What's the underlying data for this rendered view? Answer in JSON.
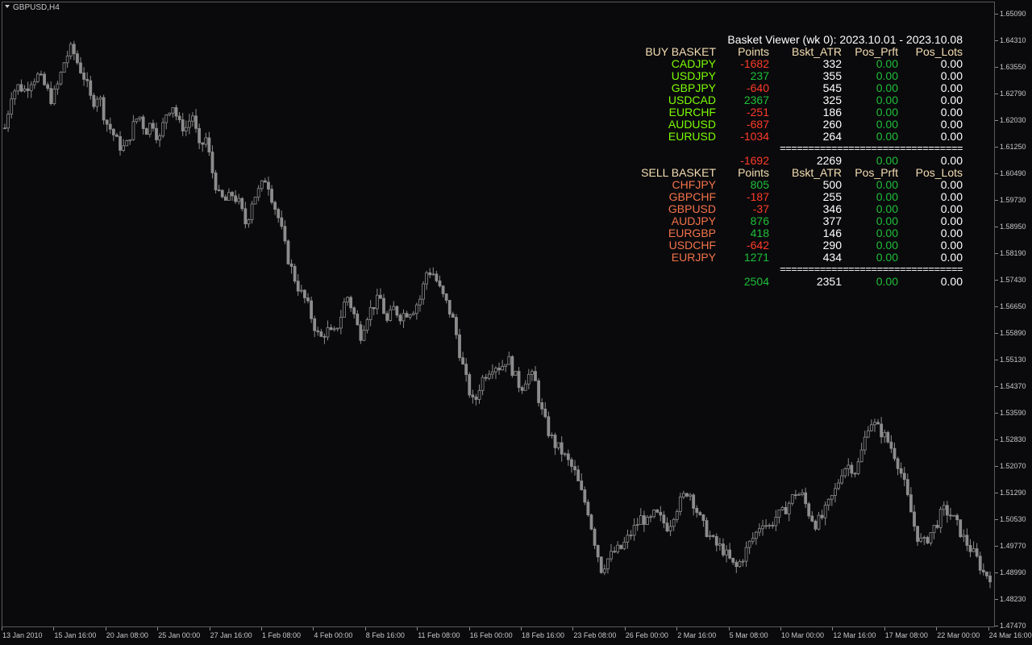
{
  "window": {
    "title": "GBPUSD,H4"
  },
  "price_axis": [
    "1.65090",
    "1.64310",
    "1.63550",
    "1.62790",
    "1.62030",
    "1.61250",
    "1.60490",
    "1.59730",
    "1.58950",
    "1.58190",
    "1.57430",
    "1.56650",
    "1.55890",
    "1.55130",
    "1.54370",
    "1.53590",
    "1.52830",
    "1.52070",
    "1.51290",
    "1.50530",
    "1.49770",
    "1.48990",
    "1.48230",
    "1.47470"
  ],
  "time_axis": [
    "13 Jan 2010",
    "15 Jan 16:00",
    "20 Jan 08:00",
    "25 Jan 00:00",
    "27 Jan 16:00",
    "1 Feb 08:00",
    "4 Feb 00:00",
    "8 Feb 16:00",
    "11 Feb 08:00",
    "16 Feb 00:00",
    "18 Feb 16:00",
    "23 Feb 08:00",
    "26 Feb 00:00",
    "2 Mar 16:00",
    "5 Mar 08:00",
    "10 Mar 00:00",
    "12 Mar 16:00",
    "17 Mar 08:00",
    "22 Mar 00:00",
    "24 Mar 16:00"
  ],
  "colors": {
    "background": "#0a0a0c",
    "candle": "#8c8c8c",
    "buy_symbol": "#7cfc00",
    "sell_symbol": "#f4734a",
    "positive": "#1fbf3a",
    "negative": "#ff3b2a",
    "header": "#f5deb3"
  },
  "basket_viewer": {
    "title": "Basket Viewer (wk 0): 2023.10.01  -   2023.10.08",
    "buy": {
      "header": {
        "name": "BUY BASKET",
        "points": "Points",
        "atr": "Bskt_ATR",
        "profit": "Pos_Prft",
        "lots": "Pos_Lots"
      },
      "rows": [
        {
          "symbol": "CADJPY",
          "points": "-1682",
          "atr": "332",
          "profit": "0.00",
          "lots": "0.00"
        },
        {
          "symbol": "USDJPY",
          "points": "237",
          "atr": "355",
          "profit": "0.00",
          "lots": "0.00"
        },
        {
          "symbol": "GBPJPY",
          "points": "-640",
          "atr": "545",
          "profit": "0.00",
          "lots": "0.00"
        },
        {
          "symbol": "USDCAD",
          "points": "2367",
          "atr": "325",
          "profit": "0.00",
          "lots": "0.00"
        },
        {
          "symbol": "EURCHF",
          "points": "-251",
          "atr": "186",
          "profit": "0.00",
          "lots": "0.00"
        },
        {
          "symbol": "AUDUSD",
          "points": "-687",
          "atr": "260",
          "profit": "0.00",
          "lots": "0.00"
        },
        {
          "symbol": "EURUSD",
          "points": "-1034",
          "atr": "264",
          "profit": "0.00",
          "lots": "0.00"
        }
      ],
      "separator": "================================",
      "total": {
        "points": "-1692",
        "atr": "2269",
        "profit": "0.00",
        "lots": "0.00"
      }
    },
    "sell": {
      "header": {
        "name": "SELL BASKET",
        "points": "Points",
        "atr": "Bskt_ATR",
        "profit": "Pos_Prft",
        "lots": "Pos_Lots"
      },
      "rows": [
        {
          "symbol": "CHFJPY",
          "points": "805",
          "atr": "500",
          "profit": "0.00",
          "lots": "0.00"
        },
        {
          "symbol": "GBPCHF",
          "points": "-187",
          "atr": "255",
          "profit": "0.00",
          "lots": "0.00"
        },
        {
          "symbol": "GBPUSD",
          "points": "-37",
          "atr": "346",
          "profit": "0.00",
          "lots": "0.00"
        },
        {
          "symbol": "AUDJPY",
          "points": "876",
          "atr": "377",
          "profit": "0.00",
          "lots": "0.00"
        },
        {
          "symbol": "EURGBP",
          "points": "418",
          "atr": "146",
          "profit": "0.00",
          "lots": "0.00"
        },
        {
          "symbol": "USDCHF",
          "points": "-642",
          "atr": "290",
          "profit": "0.00",
          "lots": "0.00"
        },
        {
          "symbol": "EURJPY",
          "points": "1271",
          "atr": "434",
          "profit": "0.00",
          "lots": "0.00"
        }
      ],
      "separator": "================================",
      "total": {
        "points": "2504",
        "atr": "2351",
        "profit": "0.00",
        "lots": "0.00"
      }
    }
  },
  "chart_data": {
    "type": "candlestick",
    "symbol": "GBPUSD",
    "timeframe": "H4",
    "ylim": [
      1.4747,
      1.6509
    ],
    "close_path": [
      1.618,
      1.628,
      1.63,
      1.629,
      1.632,
      1.633,
      1.63,
      1.626,
      1.631,
      1.638,
      1.641,
      1.636,
      1.632,
      1.625,
      1.628,
      1.62,
      1.617,
      1.613,
      1.612,
      1.618,
      1.622,
      1.617,
      1.62,
      1.614,
      1.622,
      1.625,
      1.619,
      1.618,
      1.622,
      1.612,
      1.615,
      1.605,
      1.598,
      1.597,
      1.599,
      1.596,
      1.59,
      1.598,
      1.6,
      1.604,
      1.597,
      1.591,
      1.582,
      1.576,
      1.571,
      1.568,
      1.562,
      1.557,
      1.56,
      1.558,
      1.563,
      1.57,
      1.565,
      1.558,
      1.564,
      1.567,
      1.569,
      1.562,
      1.566,
      1.564,
      1.565,
      1.566,
      1.569,
      1.577,
      1.576,
      1.571,
      1.567,
      1.562,
      1.552,
      1.544,
      1.538,
      1.545,
      1.548,
      1.55,
      1.549,
      1.552,
      1.547,
      1.543,
      1.547,
      1.546,
      1.537,
      1.531,
      1.527,
      1.525,
      1.522,
      1.519,
      1.513,
      1.508,
      1.499,
      1.491,
      1.494,
      1.496,
      1.497,
      1.5,
      1.503,
      1.506,
      1.504,
      1.507,
      1.505,
      1.503,
      1.508,
      1.511,
      1.514,
      1.509,
      1.504,
      1.501,
      1.498,
      1.497,
      1.494,
      1.491,
      1.494,
      1.498,
      1.501,
      1.505,
      1.503,
      1.506,
      1.507,
      1.51,
      1.513,
      1.512,
      1.507,
      1.504,
      1.506,
      1.51,
      1.514,
      1.52,
      1.521,
      1.519,
      1.526,
      1.534,
      1.532,
      1.53,
      1.527,
      1.523,
      1.517,
      1.509,
      1.501,
      1.498,
      1.501,
      1.504,
      1.508,
      1.507,
      1.504,
      1.5,
      1.497,
      1.494,
      1.49,
      1.489
    ]
  }
}
